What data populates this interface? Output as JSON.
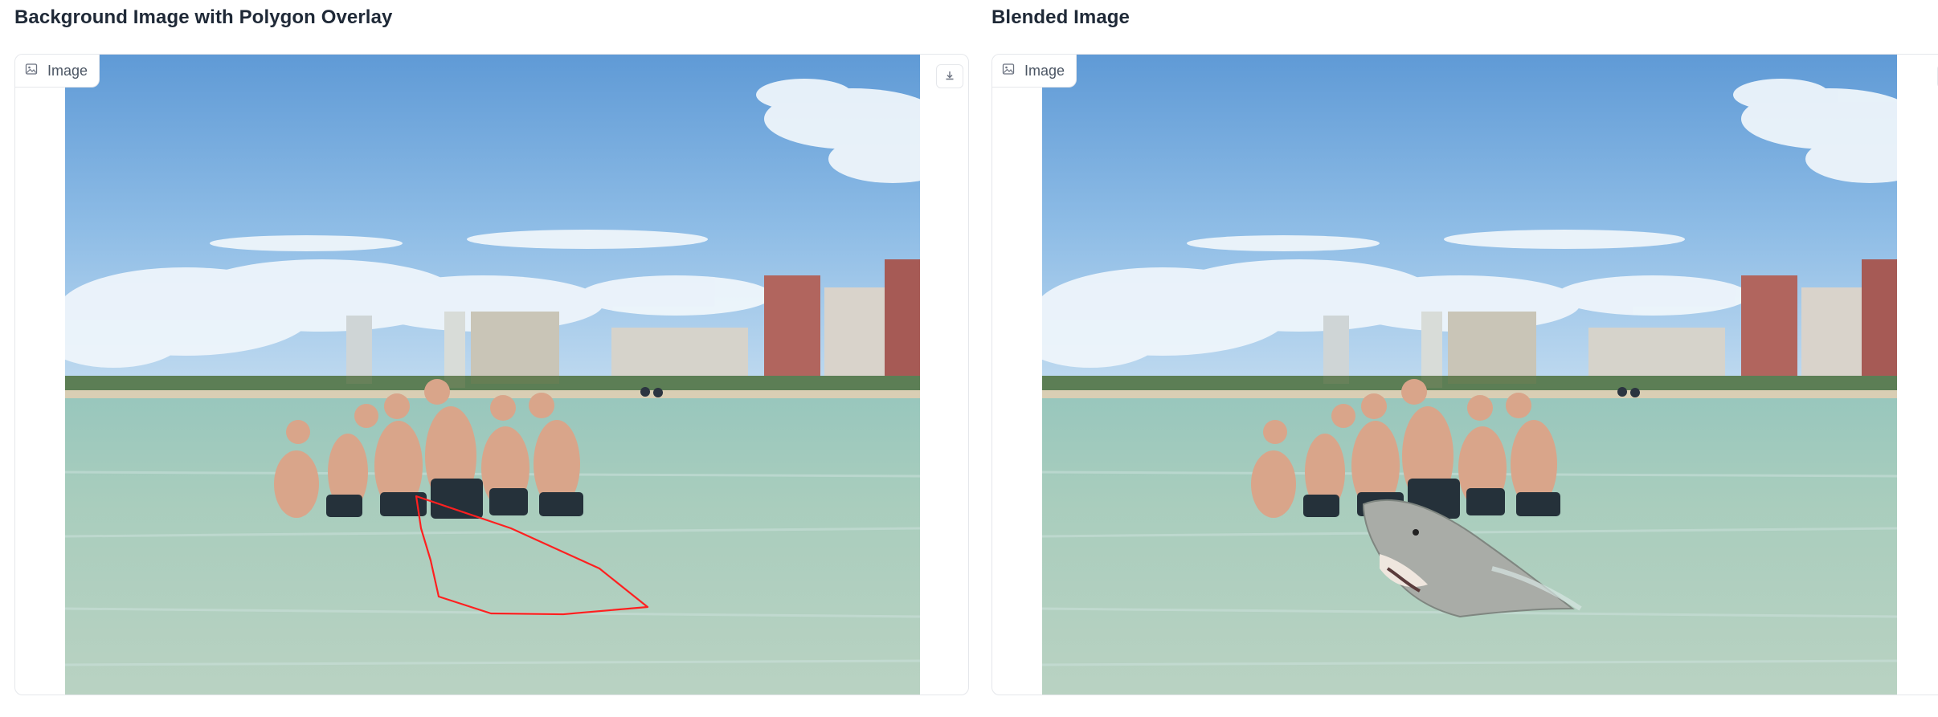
{
  "panels": [
    {
      "title": "Background Image with Polygon Overlay",
      "label": "Image",
      "icons": {
        "label": "image-icon",
        "download": "download-icon"
      },
      "overlay": "polygon"
    },
    {
      "title": "Blended Image",
      "label": "Image",
      "icons": {
        "label": "image-icon",
        "download": "download-icon"
      },
      "overlay": "shark"
    }
  ],
  "colors": {
    "polygon_stroke": "#ff2020",
    "sky": "#7fb2e2",
    "water": "#8cc3c1",
    "panel_border": "#e5e7eb"
  }
}
